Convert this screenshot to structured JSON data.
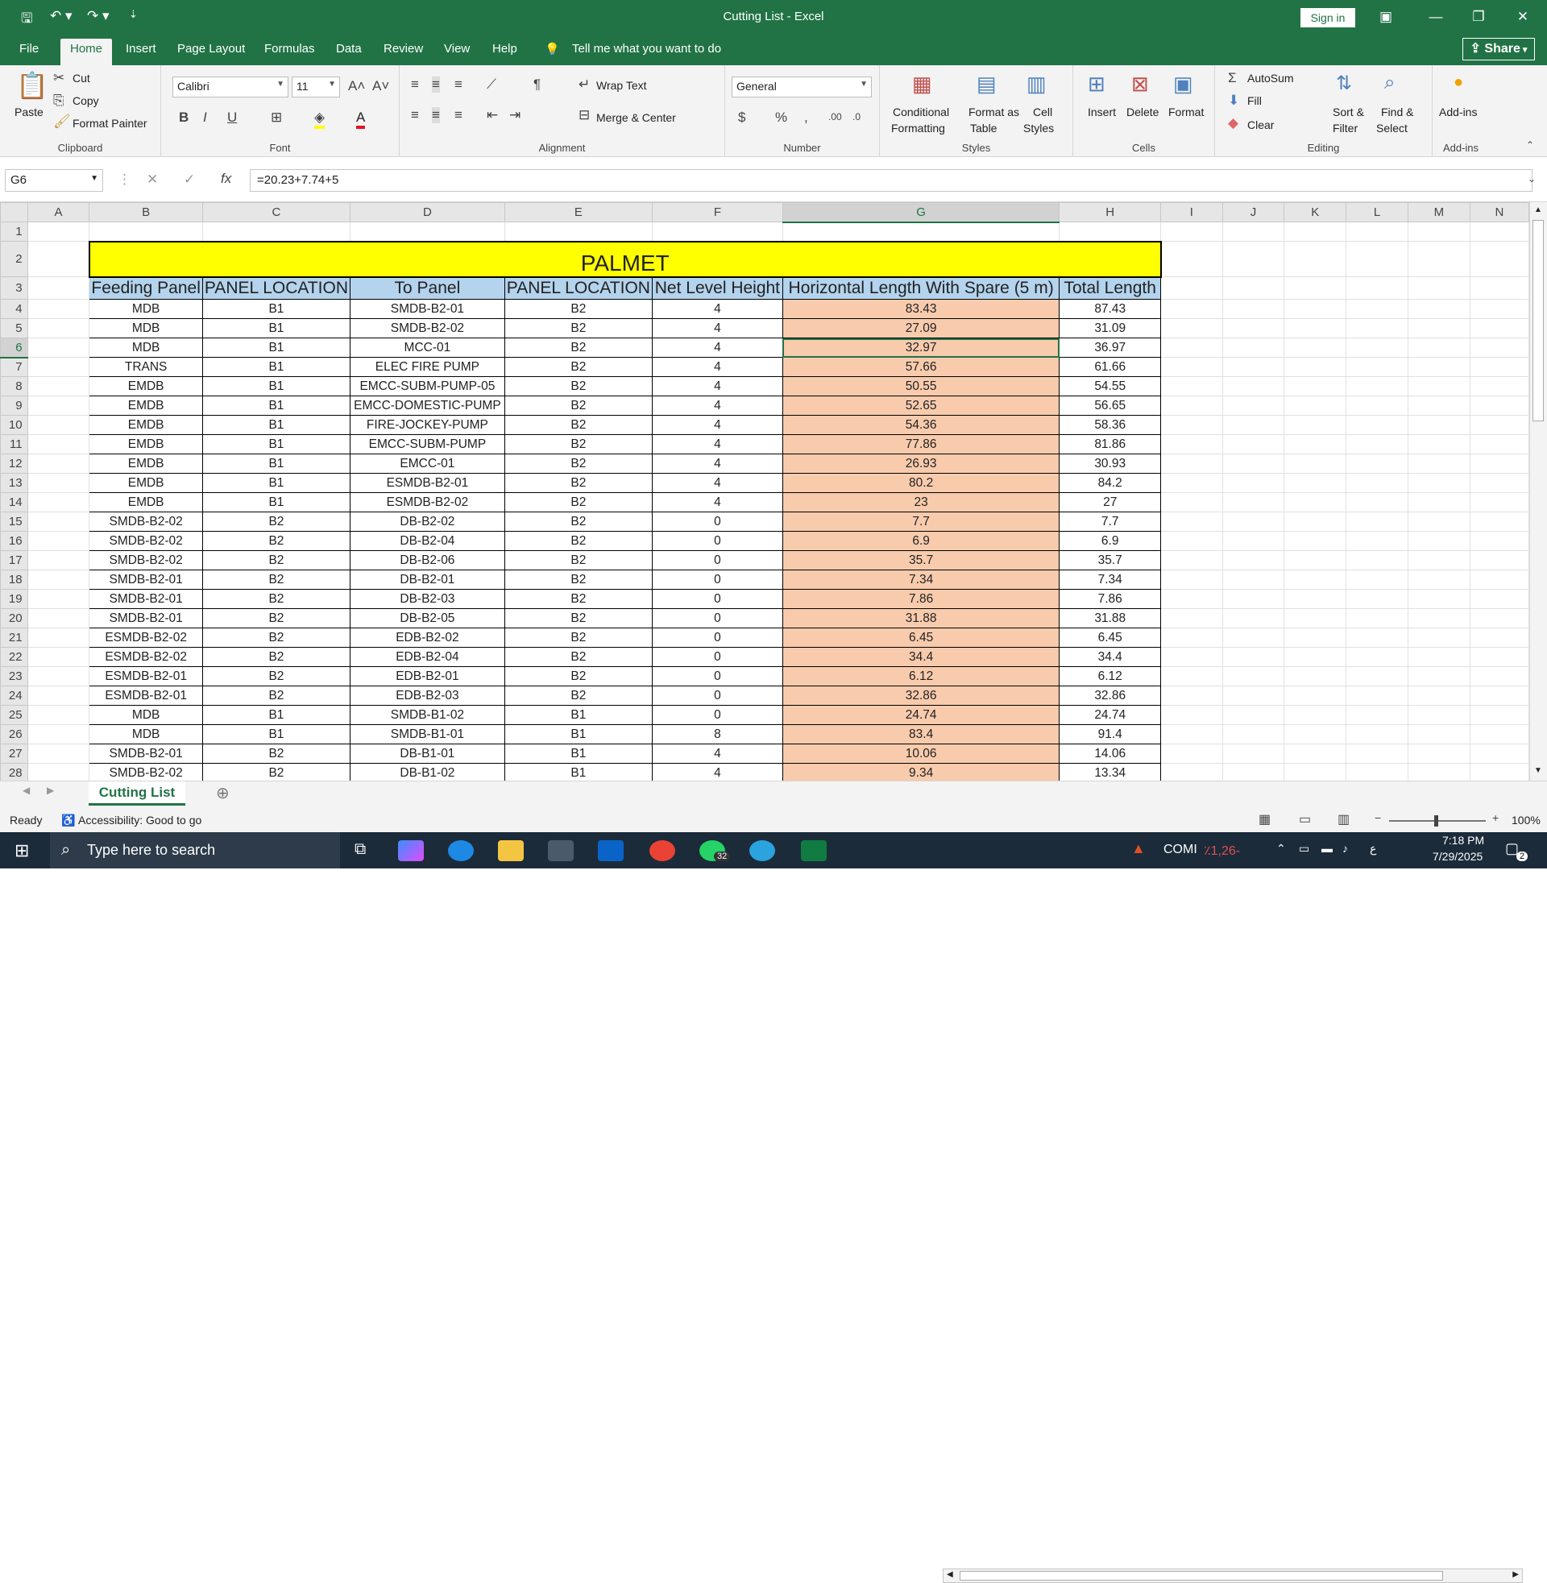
{
  "window": {
    "title": "Cutting List  -  Excel",
    "sign_in": "Sign in",
    "share": "Share"
  },
  "tabs": [
    "File",
    "Home",
    "Insert",
    "Page Layout",
    "Formulas",
    "Data",
    "Review",
    "View",
    "Help"
  ],
  "tell_me": "Tell me what you want to do",
  "ribbon": {
    "clipboard": {
      "label": "Clipboard",
      "paste": "Paste",
      "cut": "Cut",
      "copy": "Copy",
      "format_painter": "Format Painter"
    },
    "font": {
      "label": "Font",
      "name": "Calibri",
      "size": "11"
    },
    "alignment": {
      "label": "Alignment",
      "wrap": "Wrap Text",
      "merge": "Merge & Center"
    },
    "number": {
      "label": "Number",
      "format": "General"
    },
    "styles": {
      "label": "Styles",
      "cond": "Conditional",
      "cond2": "Formatting",
      "fmt_table": "Format as",
      "fmt_table2": "Table",
      "cell_styles": "Cell",
      "cell_styles2": "Styles"
    },
    "cells": {
      "label": "Cells",
      "insert": "Insert",
      "delete": "Delete",
      "format": "Format"
    },
    "editing": {
      "label": "Editing",
      "autosum": "AutoSum",
      "fill": "Fill",
      "clear": "Clear",
      "sort": "Sort &",
      "sort2": "Filter",
      "find": "Find &",
      "find2": "Select"
    },
    "addins": {
      "label": "Add-ins",
      "btn": "Add-ins"
    }
  },
  "formula_bar": {
    "cell": "G6",
    "formula": "=20.23+7.74+5"
  },
  "columns": [
    "A",
    "B",
    "C",
    "D",
    "E",
    "F",
    "G",
    "H",
    "I",
    "J",
    "K",
    "L",
    "M",
    "N"
  ],
  "sheet_title": "PALMET",
  "headers": [
    "Feeding Panel",
    "PANEL LOCATION",
    "To Panel",
    "PANEL LOCATION",
    "Net Level Height",
    "Horizontal Length With Spare (5 m)",
    "Total Length"
  ],
  "rows": [
    [
      "MDB",
      "B1",
      "SMDB-B2-01",
      "B2",
      "4",
      "83.43",
      "87.43"
    ],
    [
      "MDB",
      "B1",
      "SMDB-B2-02",
      "B2",
      "4",
      "27.09",
      "31.09"
    ],
    [
      "MDB",
      "B1",
      "MCC-01",
      "B2",
      "4",
      "32.97",
      "36.97"
    ],
    [
      "TRANS",
      "B1",
      "ELEC FIRE PUMP",
      "B2",
      "4",
      "57.66",
      "61.66"
    ],
    [
      "EMDB",
      "B1",
      "EMCC-SUBM-PUMP-05",
      "B2",
      "4",
      "50.55",
      "54.55"
    ],
    [
      "EMDB",
      "B1",
      "EMCC-DOMESTIC-PUMP",
      "B2",
      "4",
      "52.65",
      "56.65"
    ],
    [
      "EMDB",
      "B1",
      "FIRE-JOCKEY-PUMP",
      "B2",
      "4",
      "54.36",
      "58.36"
    ],
    [
      "EMDB",
      "B1",
      "EMCC-SUBM-PUMP",
      "B2",
      "4",
      "77.86",
      "81.86"
    ],
    [
      "EMDB",
      "B1",
      "EMCC-01",
      "B2",
      "4",
      "26.93",
      "30.93"
    ],
    [
      "EMDB",
      "B1",
      "ESMDB-B2-01",
      "B2",
      "4",
      "80.2",
      "84.2"
    ],
    [
      "EMDB",
      "B1",
      "ESMDB-B2-02",
      "B2",
      "4",
      "23",
      "27"
    ],
    [
      "SMDB-B2-02",
      "B2",
      "DB-B2-02",
      "B2",
      "0",
      "7.7",
      "7.7"
    ],
    [
      "SMDB-B2-02",
      "B2",
      "DB-B2-04",
      "B2",
      "0",
      "6.9",
      "6.9"
    ],
    [
      "SMDB-B2-02",
      "B2",
      "DB-B2-06",
      "B2",
      "0",
      "35.7",
      "35.7"
    ],
    [
      "SMDB-B2-01",
      "B2",
      "DB-B2-01",
      "B2",
      "0",
      "7.34",
      "7.34"
    ],
    [
      "SMDB-B2-01",
      "B2",
      "DB-B2-03",
      "B2",
      "0",
      "7.86",
      "7.86"
    ],
    [
      "SMDB-B2-01",
      "B2",
      "DB-B2-05",
      "B2",
      "0",
      "31.88",
      "31.88"
    ],
    [
      "ESMDB-B2-02",
      "B2",
      "EDB-B2-02",
      "B2",
      "0",
      "6.45",
      "6.45"
    ],
    [
      "ESMDB-B2-02",
      "B2",
      "EDB-B2-04",
      "B2",
      "0",
      "34.4",
      "34.4"
    ],
    [
      "ESMDB-B2-01",
      "B2",
      "EDB-B2-01",
      "B2",
      "0",
      "6.12",
      "6.12"
    ],
    [
      "ESMDB-B2-01",
      "B2",
      "EDB-B2-03",
      "B2",
      "0",
      "32.86",
      "32.86"
    ],
    [
      "MDB",
      "B1",
      "SMDB-B1-02",
      "B1",
      "0",
      "24.74",
      "24.74"
    ],
    [
      "MDB",
      "B1",
      "SMDB-B1-01",
      "B1",
      "8",
      "83.4",
      "91.4"
    ],
    [
      "SMDB-B2-01",
      "B2",
      "DB-B1-01",
      "B1",
      "4",
      "10.06",
      "14.06"
    ],
    [
      "SMDB-B2-02",
      "B2",
      "DB-B1-02",
      "B1",
      "4",
      "9.34",
      "13.34"
    ]
  ],
  "sheet_tab": "Cutting List",
  "status": {
    "ready": "Ready",
    "accessibility": "Accessibility: Good to go",
    "zoom": "100%"
  },
  "taskbar": {
    "search": "Type here to search",
    "ticker": "COMI",
    "ticker_val": "٪1,26-",
    "time": "7:18 PM",
    "date": "7/29/2025",
    "badge": "32",
    "notif": "2"
  }
}
